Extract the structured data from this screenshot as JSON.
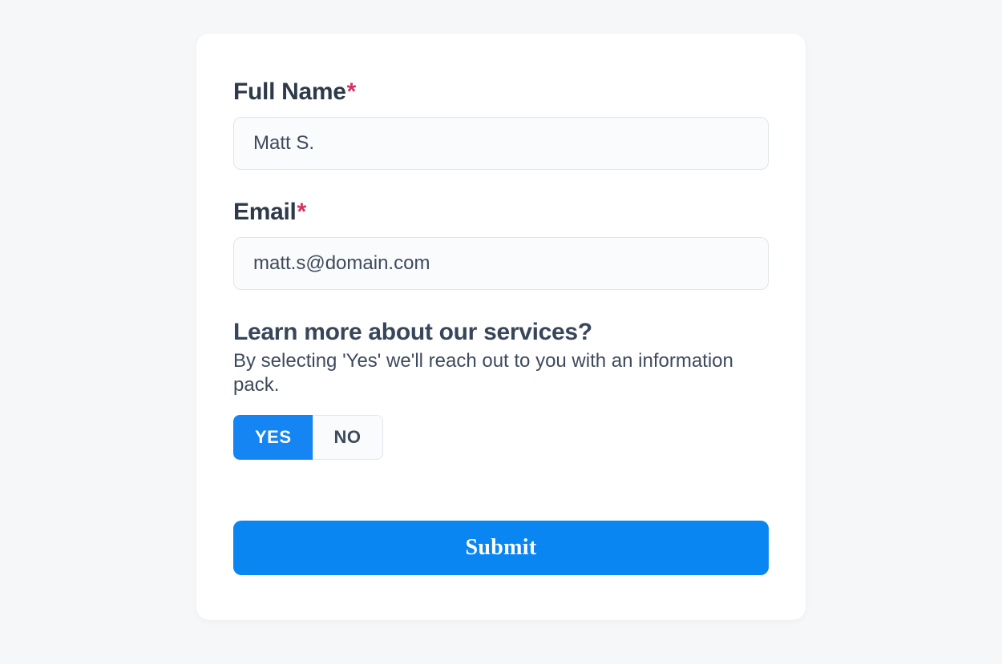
{
  "form": {
    "fullName": {
      "label": "Full Name",
      "required": "*",
      "value": "Matt S."
    },
    "email": {
      "label": "Email",
      "required": "*",
      "value": "matt.s@domain.com"
    },
    "learnMore": {
      "label": "Learn more about our services?",
      "description": "By selecting 'Yes' we'll reach out to you with an information pack.",
      "options": {
        "yes": "YES",
        "no": "NO"
      },
      "selected": "yes"
    },
    "submit": {
      "label": "Submit"
    }
  }
}
